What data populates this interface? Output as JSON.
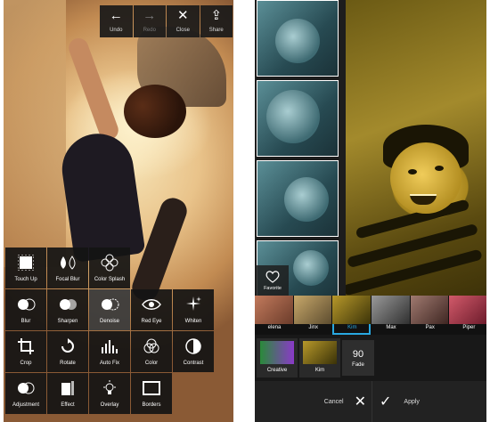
{
  "left_screen": {
    "toolbar": [
      {
        "label": "Undo",
        "icon": "arrow-left-icon",
        "glyph": "←",
        "disabled": false
      },
      {
        "label": "Redo",
        "icon": "arrow-right-icon",
        "glyph": "→",
        "disabled": true
      },
      {
        "label": "Close",
        "icon": "close-icon",
        "glyph": "✕",
        "disabled": false
      },
      {
        "label": "Share",
        "icon": "share-icon",
        "glyph": "⇪",
        "disabled": false
      }
    ],
    "tools": [
      {
        "label": "Touch Up",
        "icon": "touch-up-icon"
      },
      {
        "label": "Focal Blur",
        "icon": "focal-blur-icon"
      },
      {
        "label": "Color Splash",
        "icon": "color-splash-icon"
      },
      {
        "label": "Blur",
        "icon": "blur-icon"
      },
      {
        "label": "Sharpen",
        "icon": "sharpen-icon"
      },
      {
        "label": "Denoise",
        "icon": "denoise-icon"
      },
      {
        "label": "Red Eye",
        "icon": "red-eye-icon"
      },
      {
        "label": "Whiten",
        "icon": "whiten-icon"
      },
      {
        "label": "Crop",
        "icon": "crop-icon"
      },
      {
        "label": "Rotate",
        "icon": "rotate-icon"
      },
      {
        "label": "Auto Fix",
        "icon": "auto-fix-icon"
      },
      {
        "label": "Color",
        "icon": "color-icon"
      },
      {
        "label": "Contrast",
        "icon": "contrast-icon"
      },
      {
        "label": "Adjustment",
        "icon": "adjustment-icon"
      },
      {
        "label": "Effect",
        "icon": "effect-icon"
      },
      {
        "label": "Overlay",
        "icon": "overlay-icon"
      },
      {
        "label": "Borders",
        "icon": "borders-icon"
      }
    ]
  },
  "right_screen": {
    "favorite_label": "Favorite",
    "filters": [
      {
        "label": "elena",
        "colors": [
          "#6a3b2a",
          "#c27a5c"
        ]
      },
      {
        "label": "Jinx",
        "colors": [
          "#5a4a2e",
          "#c8a86a"
        ]
      },
      {
        "label": "Kim",
        "colors": [
          "#3a3208",
          "#b7982a"
        ],
        "selected": true
      },
      {
        "label": "Max",
        "colors": [
          "#2e2e2e",
          "#9a9a9a"
        ]
      },
      {
        "label": "Pax",
        "colors": [
          "#3c2420",
          "#a07a70"
        ]
      },
      {
        "label": "Piper",
        "colors": [
          "#6a1a2a",
          "#d25a6a"
        ]
      }
    ],
    "effects": [
      {
        "label": "Creative",
        "colors": [
          "#2a8a3a",
          "#8a3ac8"
        ]
      },
      {
        "label": "Kim",
        "colors": [
          "#3a3208",
          "#b7982a"
        ]
      }
    ],
    "fade": {
      "value": "90",
      "label": "Fade"
    },
    "cancel_label": "Cancel",
    "apply_label": "Apply"
  }
}
